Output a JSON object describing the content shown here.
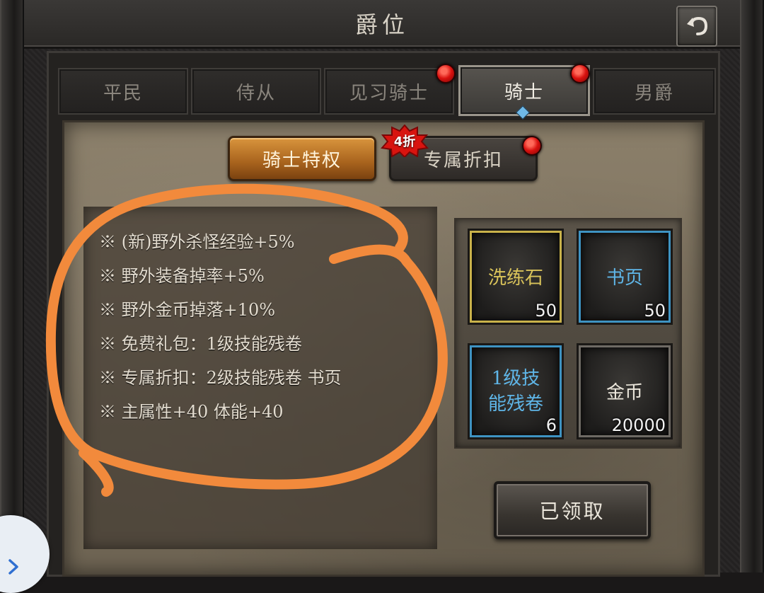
{
  "header": {
    "title": "爵位"
  },
  "tabs": [
    {
      "label": "平民",
      "active": false,
      "red_dot": false
    },
    {
      "label": "侍从",
      "active": false,
      "red_dot": false
    },
    {
      "label": "见习骑士",
      "active": false,
      "red_dot": true
    },
    {
      "label": "骑士",
      "active": true,
      "red_dot": true
    },
    {
      "label": "男爵",
      "active": false,
      "red_dot": false
    }
  ],
  "subtabs": {
    "privileges": "骑士特权",
    "discount": "专属折扣",
    "discount_badge": "4折"
  },
  "perks": [
    "※ (新)野外杀怪经验+5%",
    "※ 野外装备掉率+5%",
    "※ 野外金币掉落+10%",
    "※ 免费礼包：1级技能残卷",
    "※ 专属折扣：2级技能残卷 书页",
    "※ 主属性+40 体能+40"
  ],
  "rewards": [
    {
      "name_line1": "洗练石",
      "name_line2": "",
      "count": "50",
      "rarity": "gold",
      "name_color": "#d9c35a"
    },
    {
      "name_line1": "书页",
      "name_line2": "",
      "count": "50",
      "rarity": "blue",
      "name_color": "#5fb6e8"
    },
    {
      "name_line1": "1级技",
      "name_line2": "能残卷",
      "count": "6",
      "rarity": "blue",
      "name_color": "#5fb6e8"
    },
    {
      "name_line1": "金币",
      "name_line2": "",
      "count": "20000",
      "rarity": "grey",
      "name_color": "#ece7dc"
    }
  ],
  "claim_button": {
    "label": "已领取"
  },
  "icons": {
    "back": "back-arrow-icon",
    "nav": "chevron-right-icon"
  },
  "colors": {
    "annotation": "#f28a3c",
    "active_subtab": "#c47a28",
    "red_dot": "#d9120f"
  }
}
